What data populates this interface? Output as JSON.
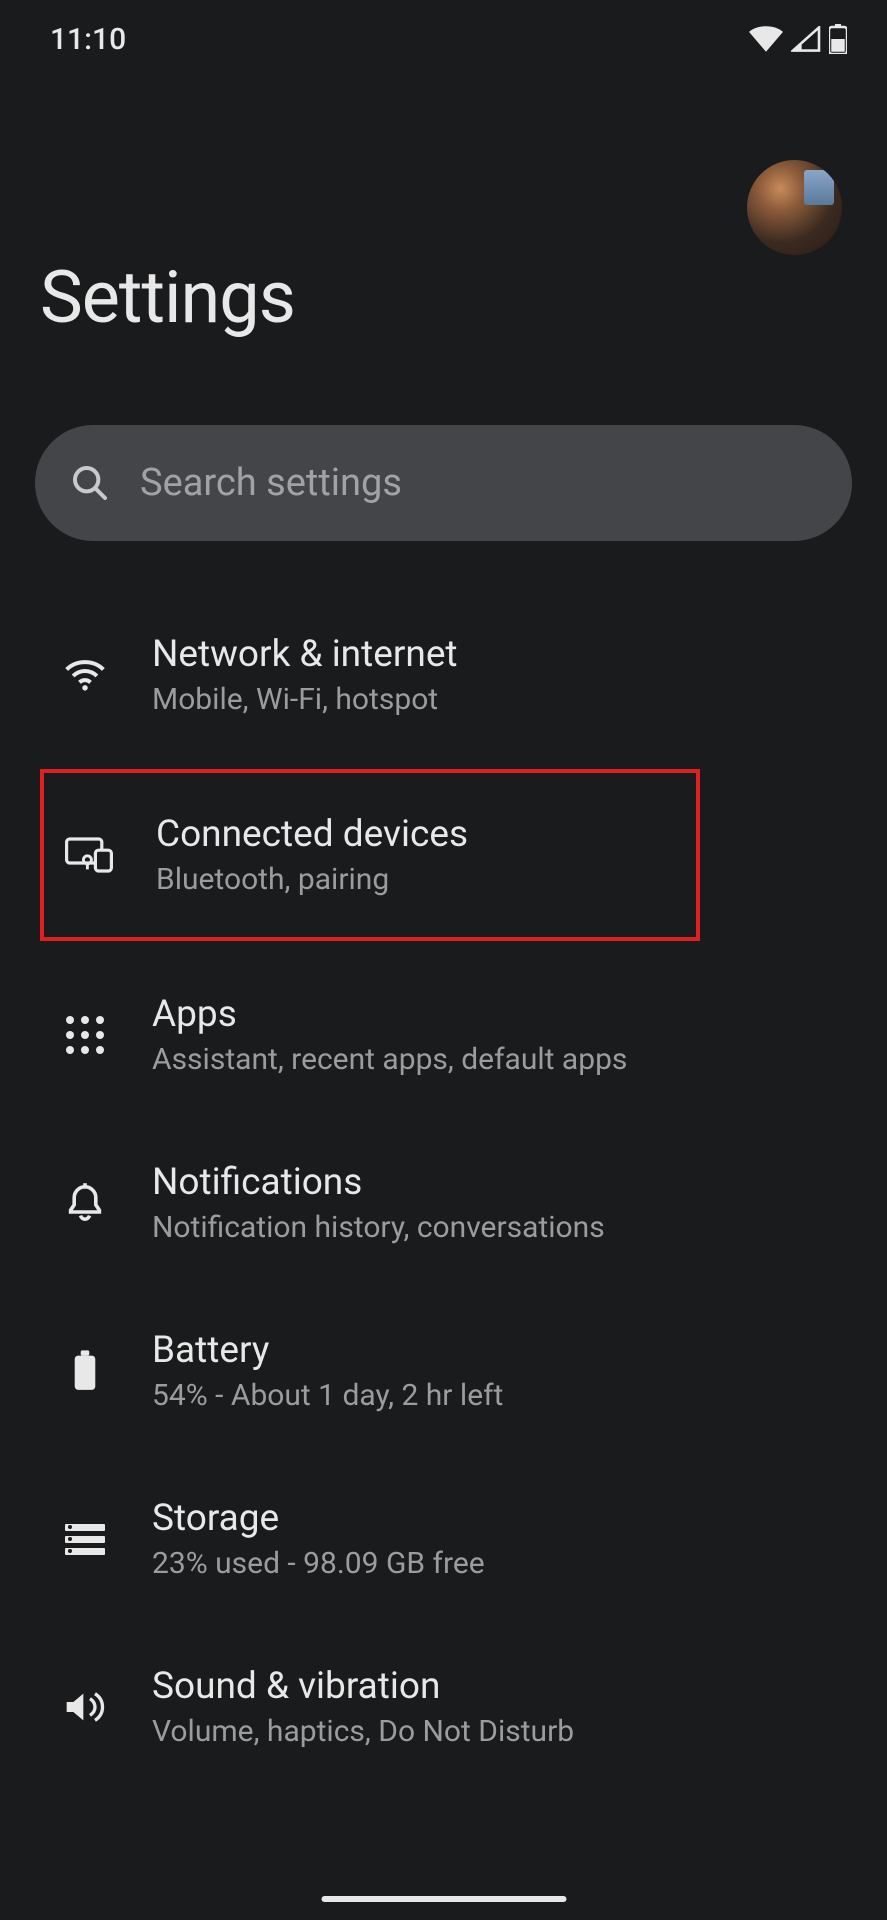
{
  "status": {
    "time": "11:10"
  },
  "page": {
    "title": "Settings"
  },
  "search": {
    "placeholder": "Search settings"
  },
  "items": [
    {
      "title": "Network & internet",
      "subtitle": "Mobile, Wi-Fi, hotspot"
    },
    {
      "title": "Connected devices",
      "subtitle": "Bluetooth, pairing"
    },
    {
      "title": "Apps",
      "subtitle": "Assistant, recent apps, default apps"
    },
    {
      "title": "Notifications",
      "subtitle": "Notification history, conversations"
    },
    {
      "title": "Battery",
      "subtitle": "54% - About 1 day, 2 hr left"
    },
    {
      "title": "Storage",
      "subtitle": "23% used - 98.09 GB free"
    },
    {
      "title": "Sound & vibration",
      "subtitle": "Volume, haptics, Do Not Disturb"
    }
  ]
}
